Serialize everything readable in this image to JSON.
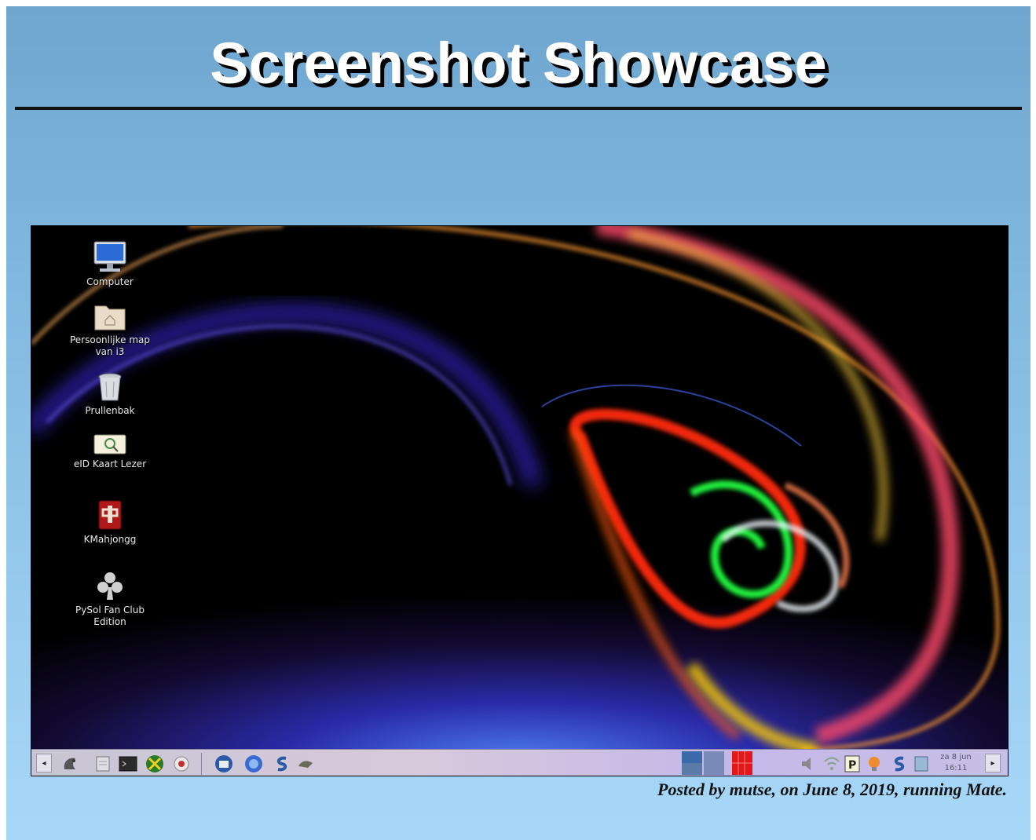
{
  "page": {
    "title": "Screenshot Showcase",
    "caption": "Posted by mutse, on June 8, 2019, running Mate."
  },
  "desktop": {
    "icons": [
      {
        "label": "Computer",
        "icon": "computer-monitor-icon"
      },
      {
        "label": "Persoonlijke map\nvan i3",
        "icon": "home-folder-icon"
      },
      {
        "label": "Prullenbak",
        "icon": "trash-icon"
      },
      {
        "label": "eID Kaart Lezer",
        "icon": "id-card-reader-icon"
      },
      {
        "label": "KMahjongg",
        "icon": "mahjongg-tile-icon"
      },
      {
        "label": "PySol Fan Club\nEdition",
        "icon": "card-club-icon"
      }
    ]
  },
  "panel": {
    "left_arrow": "◂",
    "right_arrow": "▸",
    "launchers": [
      "mate-menu-icon",
      "files-icon",
      "terminal-icon",
      "xfburn-icon",
      "settings-icon"
    ],
    "apps": [
      "thunderbird-icon",
      "firefox-icon",
      "app-s-icon",
      "app-bird-icon"
    ],
    "tray": [
      "volume-icon",
      "wifi-icon",
      "p-icon",
      "lightbulb-icon",
      "app-s-icon",
      "note-icon"
    ],
    "clock": {
      "date": "za  8 jun",
      "time": "16:11"
    }
  },
  "colors": {
    "frame_top": "#6ea6cf",
    "frame_bottom": "#a8d8f8"
  }
}
